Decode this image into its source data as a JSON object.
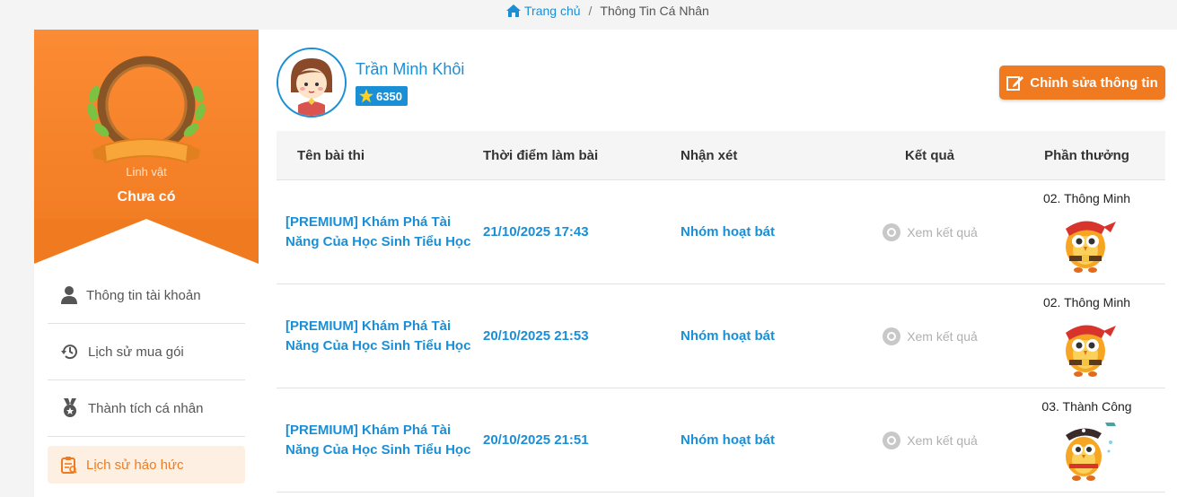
{
  "breadcrumb": {
    "home": "Trang chủ",
    "separator": "/",
    "current": "Thông Tin Cá Nhân"
  },
  "sidebar": {
    "mascot_label": "Linh vật",
    "mascot_value": "Chưa có",
    "items": [
      {
        "label": "Thông tin tài khoản",
        "icon": "user-icon"
      },
      {
        "label": "Lịch sử mua gói",
        "icon": "history-icon"
      },
      {
        "label": "Thành tích cá nhân",
        "icon": "medal-icon"
      },
      {
        "label": "Lịch sử háo hức",
        "icon": "clipboard-icon",
        "active": true
      }
    ]
  },
  "profile": {
    "name": "Trần Minh Khôi",
    "points": "6350",
    "edit_label": "Chỉnh sửa thông tin"
  },
  "table": {
    "headers": [
      "Tên bài thi",
      "Thời điểm làm bài",
      "Nhận xét",
      "Kết quả",
      "Phần thưởng"
    ],
    "rows": [
      {
        "test_name": "[PREMIUM] Khám Phá Tài Năng Của Học Sinh Tiểu Học",
        "time": "21/10/2025 17:43",
        "comment": "Nhóm hoạt bát",
        "result": "Xem kết quả",
        "reward": "02. Thông Minh"
      },
      {
        "test_name": "[PREMIUM] Khám Phá Tài Năng Của Học Sinh Tiểu Học",
        "time": "20/10/2025 21:53",
        "comment": "Nhóm hoạt bát",
        "result": "Xem kết quả",
        "reward": "02. Thông Minh"
      },
      {
        "test_name": "[PREMIUM] Khám Phá Tài Năng Của Học Sinh Tiểu Học",
        "time": "20/10/2025 21:51",
        "comment": "Nhóm hoạt bát",
        "result": "Xem kết quả",
        "reward": "03. Thành Công"
      }
    ]
  },
  "colors": {
    "accent": "#f07a20",
    "link": "#1a8fd6"
  }
}
